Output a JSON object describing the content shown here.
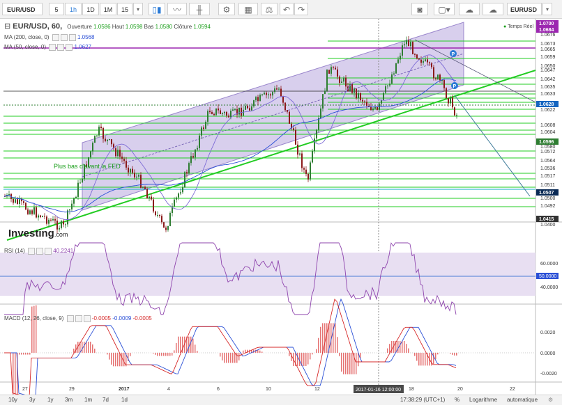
{
  "toolbar": {
    "symbol": "EUR/USD",
    "intervals": [
      "5",
      "1h",
      "1D",
      "1M",
      "15"
    ],
    "active_interval": "1h",
    "right_symbol": "EURUSD"
  },
  "legend": {
    "title": "EUR/USD, 60,",
    "open_label": "Ouverture",
    "open": "1.0586",
    "high_label": "Haut",
    "high": "1.0598",
    "low_label": "Bas",
    "low": "1.0580",
    "close_label": "Clôture",
    "close": "1.0594",
    "ma200_label": "MA (200, close, 0)",
    "ma200_value": "1.0568",
    "ma50_label": "MA (50, close, 0)",
    "ma50_value": "1.0627",
    "realtime": "Temps Réel"
  },
  "annotations": {
    "fed": "Plus bas d'avant la FED",
    "logo": "Investing",
    "logo_suffix": ".com"
  },
  "price_axis": {
    "labels": [
      "1.0676",
      "1.0673",
      "1.0665",
      "1.0659",
      "1.0650",
      "1.0647",
      "1.0642",
      "1.0635",
      "1.0633",
      "1.0622",
      "1.0608",
      "1.0604",
      "1.0580",
      "1.0572",
      "1.0564",
      "1.0536",
      "1.0517",
      "1.0511",
      "1.0500",
      "1.0492",
      "1.0400"
    ],
    "boxed": [
      {
        "text": "1.0700",
        "color": "#9c27b0"
      },
      {
        "text": "1.0684",
        "color": "#9c27b0"
      },
      {
        "text": "1.0628",
        "color": "#1565c0"
      },
      {
        "text": "1.0596",
        "color": "#2e7d32"
      },
      {
        "text": "1.0507",
        "color": "#0a2a55"
      },
      {
        "text": "1.0415",
        "color": "#333333"
      }
    ]
  },
  "rsi": {
    "label": "RSI (14)",
    "value": "40.2241",
    "axis": [
      "60.0000",
      "50.0000",
      "40.0000"
    ]
  },
  "macd": {
    "label": "MACD (12, 26, close, 9)",
    "v1": "-0.0005",
    "v2": "-0.0009",
    "v3": "-0.0005",
    "axis": [
      "0.0020",
      "0.0000",
      "-0.0020"
    ]
  },
  "time_axis": {
    "labels": [
      "27",
      "29",
      "2017",
      "4",
      "6",
      "10",
      "12",
      "18",
      "20",
      "22"
    ],
    "cursor": "2017-01-16 12:00:00"
  },
  "bottombar": {
    "ranges": [
      "10y",
      "3y",
      "1y",
      "3m",
      "1m",
      "7d",
      "1d"
    ],
    "clock": "17:38:29 (UTC+1)",
    "percent": "%",
    "log": "Logarithme",
    "auto": "automatique"
  },
  "colors": {
    "channel": "#b8a7de",
    "green": "#22cc22",
    "purple": "#9c27b0",
    "up": "#2e7d32",
    "down": "#8b1a1a"
  }
}
